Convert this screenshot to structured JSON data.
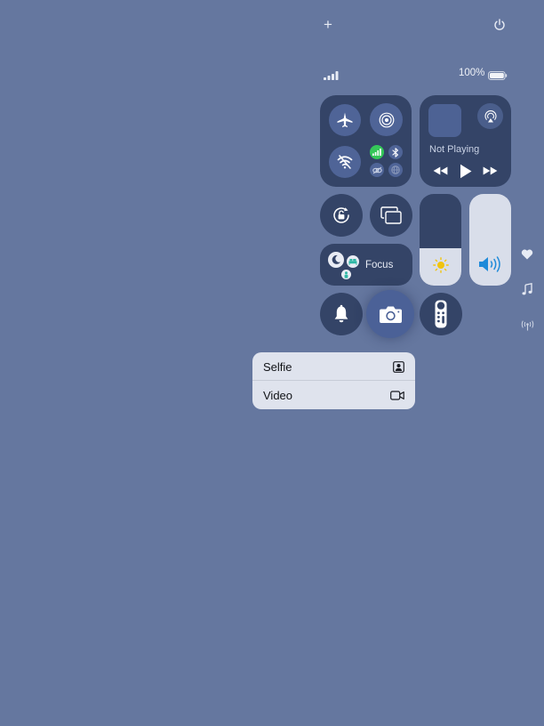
{
  "status": {
    "battery_percent": "100%",
    "battery_level": 1.0,
    "signal_bars": 4,
    "icons": [
      "add-icon",
      "power-icon",
      "signal-icon",
      "battery-icon"
    ]
  },
  "media": {
    "label": "Not Playing"
  },
  "focus": {
    "label": "Focus"
  },
  "controls": {
    "brightness_level": 0.41,
    "volume_level": 1.0
  },
  "menu": {
    "items": [
      {
        "label": "Selfie",
        "icon": "selfie-icon"
      },
      {
        "label": "Video",
        "icon": "video-camera-icon"
      }
    ]
  },
  "colors": {
    "background": "#65779f",
    "tile": "#344467",
    "active_button": "#4f6497",
    "cellular_green": "#35c759",
    "brightness_icon": "#f1c40f",
    "volume_icon": "#1f8ad9"
  }
}
